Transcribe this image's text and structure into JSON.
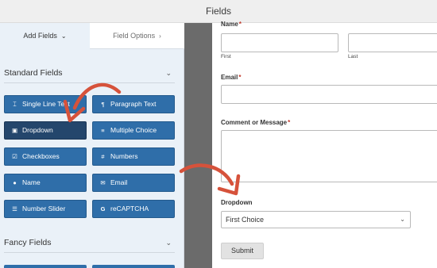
{
  "header": {
    "title": "Fields"
  },
  "tabs": {
    "add_fields": "Add Fields",
    "add_fields_icon": "chevron-down-icon",
    "field_options": "Field Options",
    "field_options_icon": "chevron-right-icon"
  },
  "sections": {
    "standard": {
      "label": "Standard Fields",
      "expanded": true
    },
    "fancy": {
      "label": "Fancy Fields",
      "expanded": true
    }
  },
  "standard_fields": [
    {
      "label": "Single Line Text",
      "icon": "text-cursor-icon"
    },
    {
      "label": "Paragraph Text",
      "icon": "pilcrow-icon"
    },
    {
      "label": "Dropdown",
      "icon": "dropdown-icon",
      "active": true
    },
    {
      "label": "Multiple Choice",
      "icon": "list-icon"
    },
    {
      "label": "Checkboxes",
      "icon": "checkbox-icon"
    },
    {
      "label": "Numbers",
      "icon": "hash-icon"
    },
    {
      "label": "Name",
      "icon": "user-icon"
    },
    {
      "label": "Email",
      "icon": "envelope-icon"
    },
    {
      "label": "Number Slider",
      "icon": "slider-icon"
    },
    {
      "label": "reCAPTCHA",
      "icon": "google-icon"
    }
  ],
  "form": {
    "name_label": "Name",
    "required_mark": "*",
    "name_first": "First",
    "name_last": "Last",
    "email_label": "Email",
    "comment_label": "Comment or Message",
    "dropdown_label": "Dropdown",
    "dropdown_value": "First Choice",
    "submit_label": "Submit"
  },
  "colors": {
    "field_button": "#2f6ea9",
    "field_button_active": "#24466c",
    "panel_bg": "#eaf1f8",
    "divider": "#6b6b6b",
    "annotation_arrow": "#d6523b",
    "required": "#c0392b"
  }
}
